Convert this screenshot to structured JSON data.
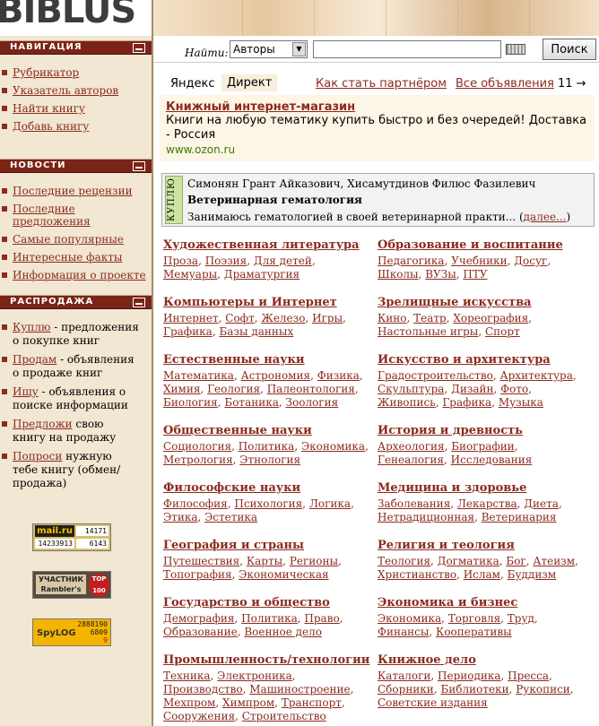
{
  "site": {
    "logo": "BIBLUS"
  },
  "sidebar": {
    "nav": {
      "heading": "НАВИГАЦИЯ",
      "items": [
        "Рубрикатор",
        "Указатель авторов",
        "Найти книгу",
        "Добавь книгу"
      ]
    },
    "news": {
      "heading": "НОВОСТИ",
      "items": [
        "Последние рецензии",
        "Последние предложения",
        "Самые популярные",
        "Интересные факты",
        "Информация о проекте"
      ]
    },
    "sale": {
      "heading": "РАСПРОДАЖА",
      "items": [
        {
          "link": "Куплю",
          "text": " - предложения о покупке книг"
        },
        {
          "link": "Продам",
          "text": " - объявления о продаже книг"
        },
        {
          "link": "Ищу",
          "text": " - объявления о поиске информации"
        },
        {
          "link": "Предложи",
          "text": " свою книгу на продажу"
        },
        {
          "link": "Попроси",
          "text": " нужную тебе книгу (обмен/продажа)"
        }
      ]
    },
    "badges": {
      "mailru": {
        "label": "mail.ru",
        "counts": [
          "14171",
          "14233913",
          "6143"
        ]
      },
      "rambler": {
        "label": "УЧАСТНИК Rambler's",
        "top": "TOP 100"
      },
      "spylog": {
        "label": "SpyLOG",
        "counts": [
          "2888190",
          "6809",
          "9"
        ]
      }
    }
  },
  "search": {
    "label": "Найти:",
    "selected": "Авторы",
    "input_value": "",
    "button": "Поиск"
  },
  "ads": {
    "yandex": "Яндекс",
    "direkt": "Директ",
    "partner": "Как стать партнёром",
    "all": "Все объявления",
    "count": "11 →",
    "title": "Книжный интернет-магазин",
    "text": "Книги на любую тематику купить быстро и без очередей! Доставка - Россия",
    "url": "www.ozon.ru"
  },
  "offer": {
    "tag": "КУПЛЮ",
    "authors": "Симонян Грант Айказович, Хисамутдинов Филюс Фазилевич",
    "title": "Ветеринарная гематология",
    "text": "Занимаюсь гематологией в своей ветеринарной практи...",
    "more": "далее..."
  },
  "categories": [
    {
      "title": "Художественная литература",
      "links": [
        "Проза",
        "Поэзия",
        "Для детей",
        "Мемуары",
        "Драматургия"
      ]
    },
    {
      "title": "Образование и воспитание",
      "links": [
        "Педагогика",
        "Учебники",
        "Досуг",
        "Школы",
        "ВУЗы",
        "ПТУ"
      ]
    },
    {
      "title": "Компьютеры и Интернет",
      "links": [
        "Интернет",
        "Софт",
        "Железо",
        "Игры",
        "Графика",
        "Базы данных"
      ]
    },
    {
      "title": "Зрелищные искусства",
      "links": [
        "Кино",
        "Театр",
        "Хореография",
        "Настольные игры",
        "Спорт"
      ]
    },
    {
      "title": "Естественные науки",
      "links": [
        "Математика",
        "Астрономия",
        "Физика",
        "Химия",
        "Геология",
        "Палеонтология",
        "Биология",
        "Ботаника",
        "Зоология"
      ]
    },
    {
      "title": "Искусство и архитектура",
      "links": [
        "Градостроительство",
        "Архитектура",
        "Скульптура",
        "Дизайн",
        "Фото",
        "Живопись",
        "Графика",
        "Музыка"
      ]
    },
    {
      "title": "Общественные науки",
      "links": [
        "Социология",
        "Политика",
        "Экономика",
        "Метрология",
        "Этнология"
      ]
    },
    {
      "title": "История и древность",
      "links": [
        "Археология",
        "Биографии",
        "Генеалогия",
        "Исследования"
      ]
    },
    {
      "title": "Философские науки",
      "links": [
        "Философия",
        "Психология",
        "Логика",
        "Этика",
        "Эстетика"
      ]
    },
    {
      "title": "Медицина и здоровье",
      "links": [
        "Заболевания",
        "Лекарства",
        "Диета",
        "Нетрадиционная",
        "Ветеринария"
      ]
    },
    {
      "title": "География и страны",
      "links": [
        "Путешествия",
        "Карты",
        "Регионы",
        "Топография",
        "Экономическая"
      ]
    },
    {
      "title": "Религия и теология",
      "links": [
        "Теология",
        "Догматика",
        "Бог",
        "Атеизм",
        "Христианство",
        "Ислам",
        "Буддизм"
      ]
    },
    {
      "title": "Государство и общество",
      "links": [
        "Демография",
        "Политика",
        "Право",
        "Образование",
        "Военное дело"
      ]
    },
    {
      "title": "Экономика и бизнес",
      "links": [
        "Экономика",
        "Торговля",
        "Труд",
        "Финансы",
        "Кооперативы"
      ]
    },
    {
      "title": "Промышленность/технологии",
      "links": [
        "Техника",
        "Электроника",
        "Производство",
        "Машиностроение",
        "Мехпром",
        "Химпром",
        "Транспорт",
        "Сооружения",
        "Строительство"
      ]
    },
    {
      "title": "Книжное дело",
      "links": [
        "Каталоги",
        "Периодика",
        "Пресса",
        "Сборники",
        "Библиотеки",
        "Рукописи",
        "Советские издания"
      ]
    }
  ]
}
